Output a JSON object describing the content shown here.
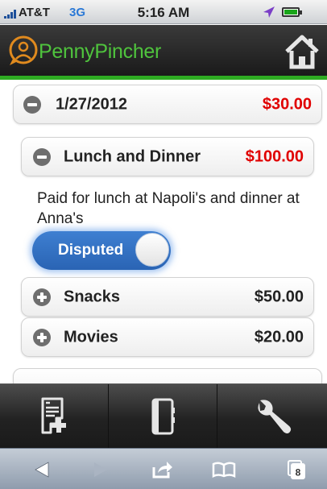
{
  "status_bar": {
    "carrier": "AT&T",
    "network": "3G",
    "time": "5:16 AM"
  },
  "header": {
    "app_name": "PennyPincher",
    "accent_color": "#2eab22",
    "home_icon": "home-icon"
  },
  "entries": [
    {
      "date": "1/27/2012",
      "total": "$30.00",
      "expanded": true,
      "items": [
        {
          "name": "Lunch and Dinner",
          "amount": "$100.00",
          "expanded": true,
          "description": "Paid for lunch at Napoli's and dinner at Anna's",
          "status_toggle": {
            "label": "Disputed",
            "on": true
          }
        },
        {
          "name": "Snacks",
          "amount": "$50.00",
          "expanded": false
        },
        {
          "name": "Movies",
          "amount": "$20.00",
          "expanded": false
        }
      ]
    }
  ],
  "tab_bar": {
    "tabs": [
      {
        "icon": "new-receipt-icon"
      },
      {
        "icon": "notebook-icon"
      },
      {
        "icon": "wrench-icon"
      }
    ]
  },
  "safari_toolbar": {
    "buttons": [
      "back-icon",
      "forward-icon",
      "share-icon",
      "bookmarks-icon",
      "tabs-icon"
    ],
    "open_tabs": "8"
  }
}
